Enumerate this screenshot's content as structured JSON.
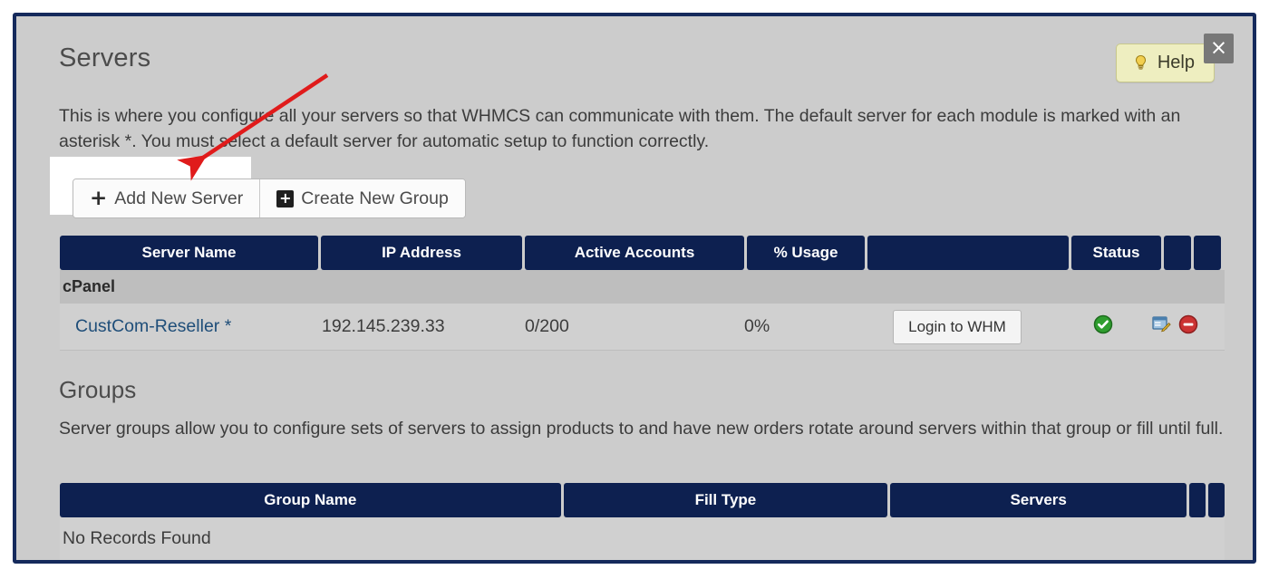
{
  "window": {
    "close_label": "×"
  },
  "header": {
    "title": "Servers",
    "help_label": "Help",
    "help_icon": "lightbulb-icon"
  },
  "intro": {
    "text": "This is where you configure all your servers so that WHMCS can communicate with them. The default server for each module is marked with an asterisk *. You must select a default server for automatic setup to function correctly."
  },
  "toolbar": {
    "add_server_label": "Add New Server",
    "add_server_icon": "plus-icon",
    "create_group_label": "Create New Group",
    "create_group_icon": "plus-square-icon"
  },
  "servers_table": {
    "columns": [
      "Server Name",
      "IP Address",
      "Active Accounts",
      "% Usage",
      "",
      "Status",
      "",
      ""
    ],
    "groups": [
      {
        "name": "cPanel",
        "rows": [
          {
            "server_name": "CustCom-Reseller *",
            "ip_address": "192.145.239.33",
            "active_accounts": "0/200",
            "usage": "0%",
            "action_label": "Login to WHM",
            "status_icon": "green-check-icon",
            "edit_icon": "edit-icon",
            "delete_icon": "red-minus-icon"
          }
        ]
      }
    ]
  },
  "groups_section": {
    "title": "Groups",
    "text": "Server groups allow you to configure sets of servers to assign products to and have new orders rotate around servers within that group or fill until full.",
    "columns": [
      "Group Name",
      "Fill Type",
      "Servers",
      "",
      ""
    ],
    "empty_message": "No Records Found"
  },
  "annotation": {
    "arrow_color": "#e01b1b",
    "highlight_color": "#ffffff"
  },
  "colors": {
    "frame": "#152a5c",
    "panel_bg": "#cccccc",
    "header_navy": "#0d2050",
    "group_row": "#bebebe",
    "data_row": "#d0d0d0",
    "help_bg": "#eeeec0"
  }
}
